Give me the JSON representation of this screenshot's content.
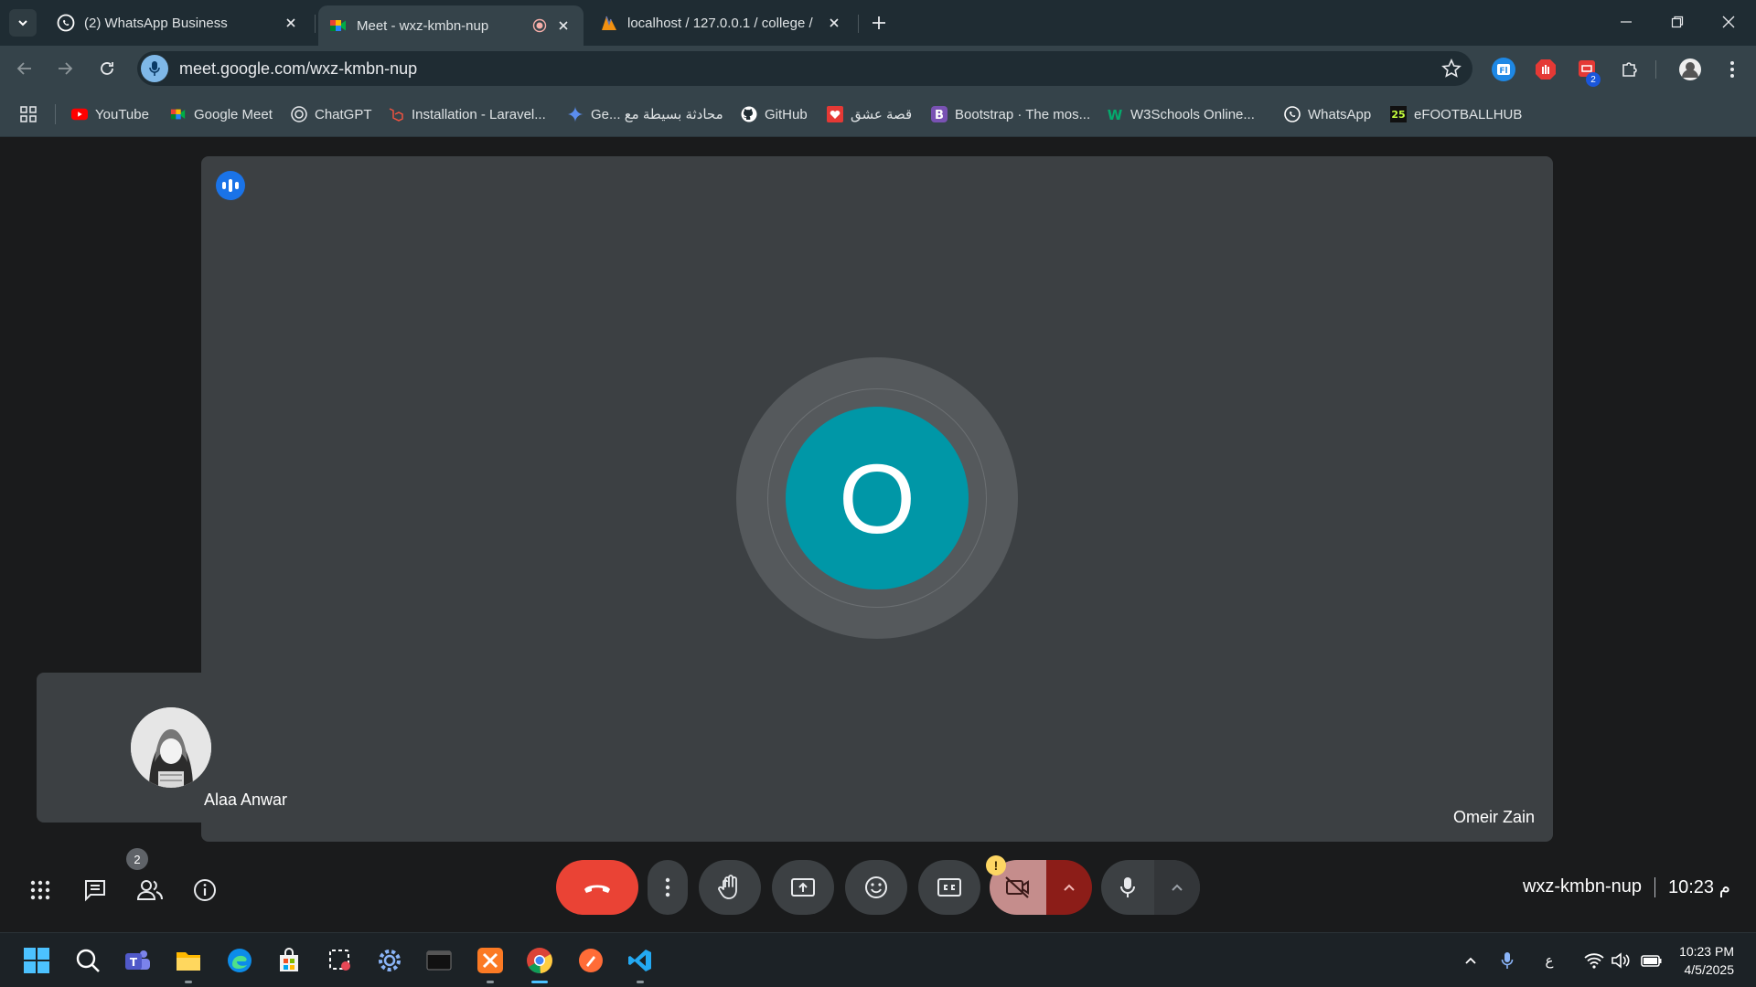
{
  "browser": {
    "tabs": [
      {
        "title": "(2) WhatsApp Business",
        "icon": "whatsapp-icon"
      },
      {
        "title": "Meet - wxz-kmbn-nup",
        "icon": "google-meet-icon",
        "active": true
      },
      {
        "title": "localhost / 127.0.0.1 / college / ",
        "icon": "phpmyadmin-icon"
      }
    ],
    "url": "meet.google.com/wxz-kmbn-nup",
    "extension_badge": "2"
  },
  "bookmarks": [
    {
      "label": "YouTube",
      "icon": "youtube-icon"
    },
    {
      "label": "Google Meet",
      "icon": "google-meet-icon"
    },
    {
      "label": "ChatGPT",
      "icon": "chatgpt-icon"
    },
    {
      "label": "Installation - Laravel...",
      "icon": "laravel-icon"
    },
    {
      "label": "Ge... محادثة بسيطة مع",
      "icon": "gemini-icon"
    },
    {
      "label": "GitHub",
      "icon": "github-icon"
    },
    {
      "label": "قصة عشق",
      "icon": "heart-icon"
    },
    {
      "label": "Bootstrap · The mos...",
      "icon": "bootstrap-icon"
    },
    {
      "label": "W3Schools Online...",
      "icon": "w3schools-icon"
    },
    {
      "label": "WhatsApp",
      "icon": "whatsapp-icon"
    },
    {
      "label": "eFOOTBALLHUB",
      "icon": "efootballhub-icon"
    }
  ],
  "meet": {
    "main_participant": {
      "initial": "O",
      "name": "Omeir Zain"
    },
    "self_participant": {
      "name": "Alaa Anwar"
    },
    "people_count": "2",
    "camera_warning": "!",
    "meeting_code": "wxz-kmbn-nup",
    "time": "10:23 م"
  },
  "taskbar": {
    "time": "10:23 PM",
    "date": "4/5/2025",
    "input_language": "ع"
  },
  "colors": {
    "avatar_bg": "#0097a7",
    "end_call": "#ea4335",
    "camera_off": "#c58d8c"
  }
}
